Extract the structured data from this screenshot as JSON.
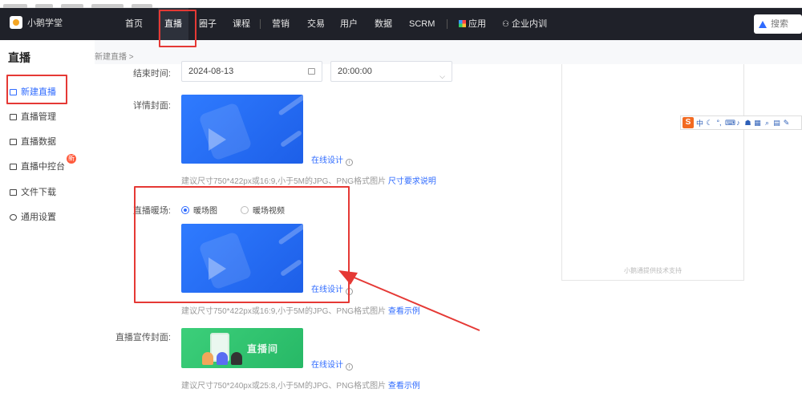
{
  "app": {
    "name": "小鹅学堂"
  },
  "nav": {
    "items": [
      "首页",
      "直播",
      "圈子",
      "课程",
      "营销",
      "交易",
      "用户",
      "数据",
      "SCRM",
      "应用",
      "企业内训"
    ]
  },
  "search": {
    "placeholder": "搜索"
  },
  "sidebar": {
    "title": "直播",
    "items": [
      {
        "label": "新建直播"
      },
      {
        "label": "直播管理"
      },
      {
        "label": "直播数据"
      },
      {
        "label": "直播中控台",
        "badge": "新"
      },
      {
        "label": "文件下载"
      },
      {
        "label": "通用设置"
      }
    ]
  },
  "breadcrumb": {
    "text": "新建直播 >"
  },
  "form": {
    "end_time": {
      "label": "结束时间:",
      "date": "2024-08-13",
      "time": "20:00:00"
    },
    "detail_cover": {
      "label": "详情封面:",
      "design_link": "在线设计"
    },
    "hint1": {
      "text": "建议尺寸750*422px或16:9,小于5M的JPG、PNG格式图片",
      "link": "尺寸要求说明"
    },
    "warmup": {
      "label": "直播暖场:",
      "option1": "暖场图",
      "option2": "暖场视频",
      "design_link": "在线设计"
    },
    "hint2": {
      "text": "建议尺寸750*422px或16:9,小于5M的JPG、PNG格式图片",
      "link": "查看示例"
    },
    "promo": {
      "label": "直播宣传封面:",
      "banner_text": "直播间",
      "design_link": "在线设计"
    },
    "hint3": {
      "text": "建议尺寸750*240px或25:8,小于5M的JPG、PNG格式图片",
      "link": "查看示例"
    }
  },
  "preview": {
    "footer": "小鹅通提供技术支持"
  },
  "ime": {
    "logo": "S",
    "mode": "中"
  },
  "colors": {
    "accent": "#2f6bff",
    "annotation": "#e53935",
    "navbar": "#1f2129"
  }
}
